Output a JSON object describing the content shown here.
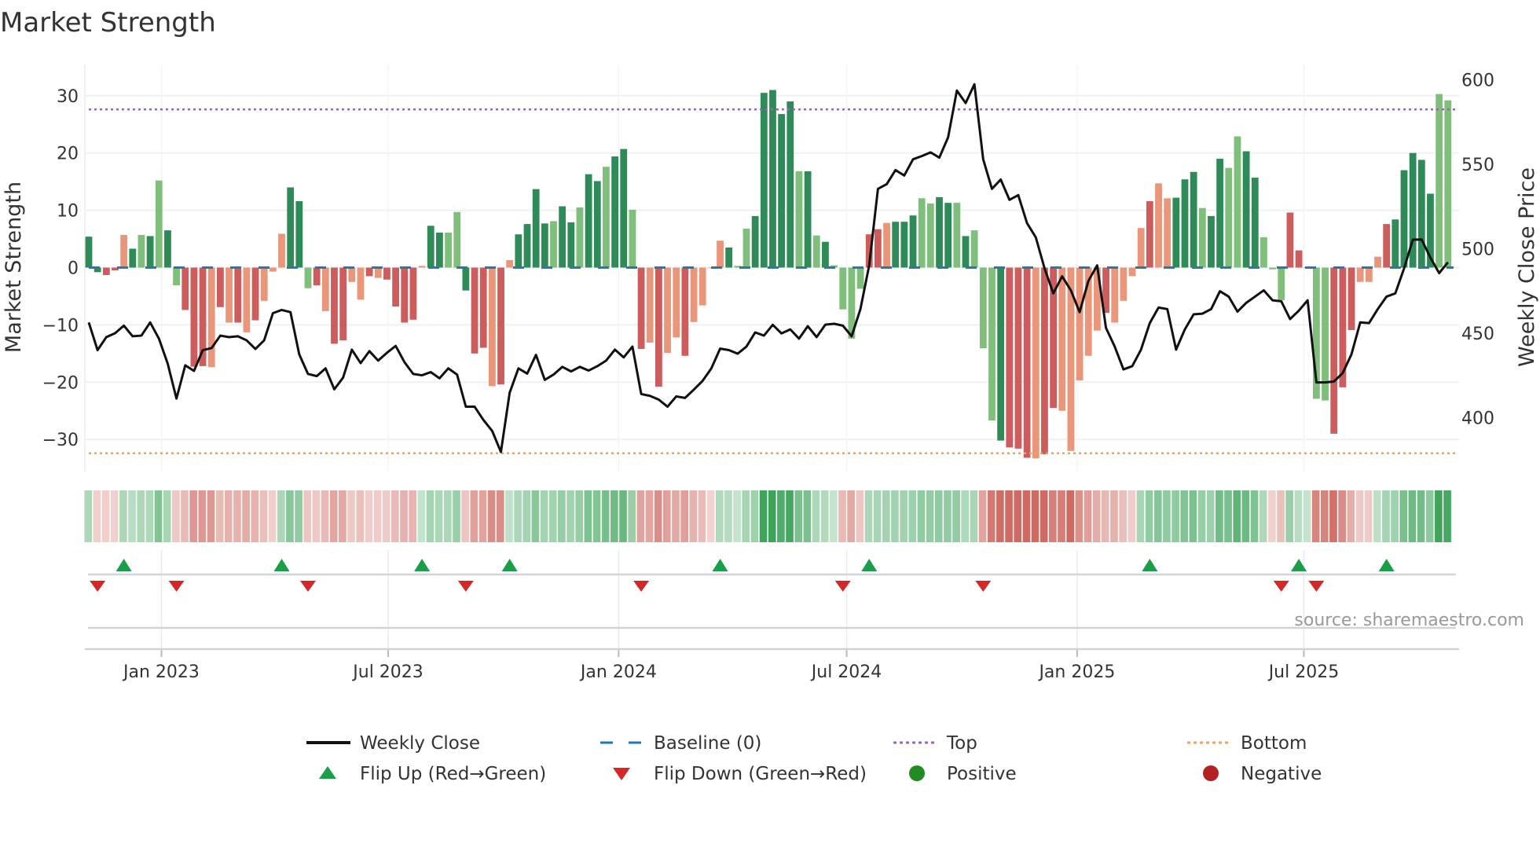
{
  "chart_data": {
    "type": "bar+line",
    "title": "Market Strength",
    "ylabel": "Market Strength",
    "y2label": "Weekly Close Price",
    "ylim": [
      -35,
      36
    ],
    "y2lim": [
      372,
      612
    ],
    "yticks": [
      "30",
      "20",
      "10",
      "0",
      "−10",
      "−20",
      "−30"
    ],
    "yticks_values": [
      30,
      20,
      10,
      0,
      -10,
      -20,
      -30
    ],
    "y2ticks": [
      "600",
      "550",
      "500",
      "450",
      "400"
    ],
    "y2ticks_values": [
      600,
      550,
      500,
      450,
      400
    ],
    "start_week": "2022-11-04",
    "interval_days": 7,
    "x_ticks": [
      {
        "label": "Jan 2023",
        "date": "2023-01-01"
      },
      {
        "label": "Jul 2023",
        "date": "2023-07-01"
      },
      {
        "label": "Jan 2024",
        "date": "2024-01-01"
      },
      {
        "label": "Jul 2024",
        "date": "2024-07-01"
      },
      {
        "label": "Jan 2025",
        "date": "2025-01-01"
      },
      {
        "label": "Jul 2025",
        "date": "2025-07-01"
      }
    ],
    "top_level": 27.6,
    "bottom_level": -32.4,
    "baseline": 0,
    "strength": [
      5.4,
      -0.8,
      -1.3,
      -0.5,
      5.7,
      3.3,
      5.7,
      5.5,
      15.2,
      6.5,
      -3.1,
      -7.4,
      -17.3,
      -17.2,
      -17.4,
      -6.9,
      -9.6,
      -9.6,
      -11.3,
      -9.2,
      -5.8,
      -0.7,
      5.9,
      14.0,
      11.6,
      -3.6,
      -3.1,
      -7.6,
      -13.3,
      -12.7,
      -2.5,
      -5.6,
      -1.5,
      -1.8,
      -2.1,
      -6.8,
      -9.6,
      -9.1,
      0.3,
      7.3,
      6.1,
      6.1,
      9.7,
      -4.0,
      -15.0,
      -14.0,
      -20.7,
      -20.4,
      1.3,
      5.8,
      7.6,
      13.7,
      7.7,
      8.1,
      10.7,
      7.9,
      10.5,
      16.3,
      15.1,
      17.6,
      19.4,
      20.7,
      10.1,
      -14.2,
      -13.1,
      -20.8,
      -14.9,
      -12.2,
      -15.4,
      -9.5,
      -6.6,
      -0.1,
      4.7,
      3.5,
      0.3,
      6.8,
      9.0,
      30.5,
      31.0,
      26.8,
      29.0,
      16.8,
      16.8,
      5.6,
      4.5,
      0.4,
      -7.3,
      -12.4,
      -3.7,
      5.8,
      6.7,
      7.8,
      8.0,
      8.0,
      9.1,
      12.1,
      11.2,
      12.3,
      11.3,
      11.3,
      5.5,
      6.5,
      -14.1,
      -26.7,
      -30.2,
      -31.4,
      -31.6,
      -33.2,
      -33.3,
      -32.6,
      -24.5,
      -25.0,
      -32.0,
      -19.7,
      -15.4,
      -11.0,
      -7.9,
      -9.6,
      -5.8,
      -1.5,
      6.9,
      11.6,
      14.7,
      12.1,
      12.2,
      15.4,
      16.7,
      10.4,
      9.0,
      19.0,
      17.4,
      22.9,
      20.3,
      15.7,
      5.3,
      -0.3,
      -5.7,
      9.6,
      3.0,
      0.0,
      -22.9,
      -23.2,
      -29.0,
      -20.9,
      -10.9,
      -2.5,
      -2.5,
      1.9,
      7.6,
      8.4,
      17.0,
      20.0,
      18.8,
      12.9,
      30.3,
      29.2
    ],
    "bar_state": "ddrrsdldldlrrrsrsrsrsssddlrsrrssrsrrrrsddlldrrsrsddddlddlddlddlrsrssrssssdlldddddldldllllrrsdddlldd",
    "bar_state_tail": "ldllldrrrsrrsssssrssssrssdddlddllddlllrrdllrrrsssrdddddlldl",
    "close": [
      456.4,
      440.0,
      447.7,
      450.0,
      454.5,
      448.2,
      448.6,
      456.4,
      446.8,
      432.0,
      411.3,
      431.0,
      427.7,
      440.0,
      441.2,
      448.6,
      447.7,
      448.2,
      445.8,
      440.7,
      445.8,
      461.9,
      463.8,
      462.5,
      437.5,
      425.9,
      424.6,
      429.2,
      416.8,
      423.7,
      440.3,
      432.3,
      439.4,
      433.8,
      438.4,
      442.5,
      432.9,
      425.9,
      425.1,
      427.0,
      423.3,
      429.2,
      425.5,
      406.5,
      406.5,
      398.7,
      392.2,
      379.7,
      414.8,
      429.2,
      426.1,
      437.2,
      422.4,
      425.5,
      430.1,
      427.4,
      430.1,
      427.9,
      430.5,
      433.8,
      440.3,
      435.7,
      442.1,
      414.0,
      412.9,
      410.7,
      406.5,
      412.6,
      411.7,
      416.6,
      421.8,
      429.2,
      440.9,
      440.0,
      437.9,
      442.1,
      450.5,
      448.6,
      455.0,
      449.9,
      452.3,
      446.8,
      454.2,
      447.7,
      455.1,
      455.6,
      454.5,
      448.2,
      464.3,
      490.2,
      535.5,
      538.3,
      546.6,
      543.4,
      553.0,
      554.9,
      557.1,
      554.0,
      566.0,
      593.7,
      586.3,
      597.4,
      553.0,
      535.5,
      541.0,
      529.0,
      531.8,
      515.2,
      506.8,
      488.4,
      473.6,
      483.7,
      475.4,
      462.5,
      481.0,
      490.2,
      453.2,
      442.1,
      428.6,
      430.5,
      440.3,
      456.0,
      465.2,
      464.3,
      440.3,
      452.3,
      461.2,
      461.6,
      464.3,
      474.9,
      471.7,
      462.8,
      468.0,
      471.7,
      475.4,
      469.5,
      468.9,
      458.4,
      463.4,
      469.5,
      420.9,
      420.9,
      421.4,
      426.4,
      437.5,
      456.4,
      456.0,
      464.3,
      471.7,
      473.6,
      488.4,
      505.4,
      505.5,
      494.8,
      485.6,
      492.0
    ],
    "flip_up_weeks": [
      4,
      22,
      38,
      48,
      72,
      89,
      121,
      138,
      148
    ],
    "flip_down_weeks": [
      1,
      10,
      25,
      43,
      63,
      86,
      102,
      136,
      140
    ],
    "legend": [
      {
        "label": "Weekly Close",
        "symbol": "line",
        "color": "#111111"
      },
      {
        "label": "Baseline (0)",
        "symbol": "dash",
        "color": "#1f77b4"
      },
      {
        "label": "Top",
        "symbol": "dot",
        "color": "#9467bd"
      },
      {
        "label": "Bottom",
        "symbol": "dot",
        "color": "#f0a060"
      },
      {
        "label": "Flip Up (Red→Green)",
        "symbol": "triangle-up",
        "color": "#1a9e4a"
      },
      {
        "label": "Flip Down (Green→Red)",
        "symbol": "triangle-down",
        "color": "#d62728"
      },
      {
        "label": "Positive",
        "symbol": "circle",
        "color": "#228b22"
      },
      {
        "label": "Negative",
        "symbol": "circle",
        "color": "#b22222"
      }
    ],
    "legend_placement": "bottom",
    "source": "source: sharemaestro.com",
    "colors": {
      "strong_pos": "#2e8b57",
      "weak_pos": "#7fbf7b",
      "strong_neg": "#cd5c5c",
      "weak_neg": "#e9967a"
    }
  }
}
